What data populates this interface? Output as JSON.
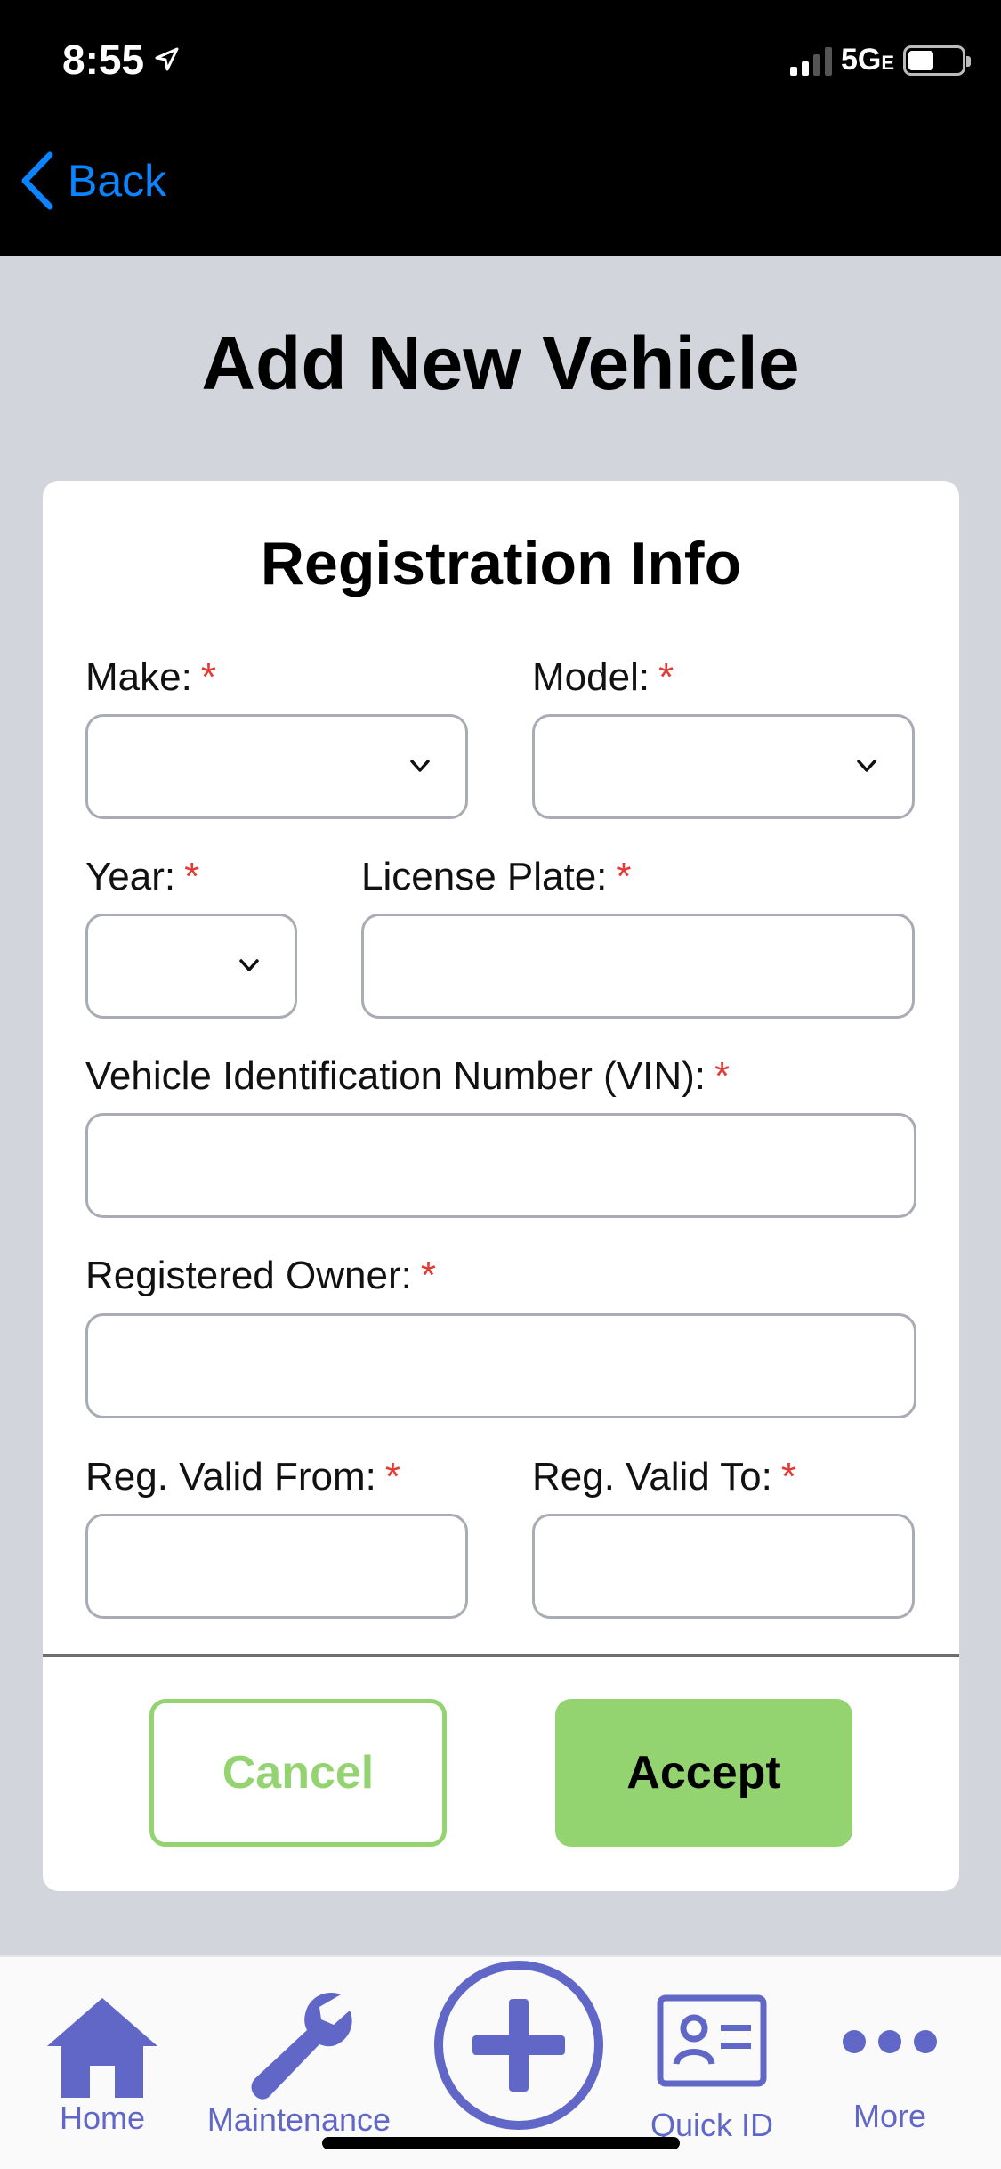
{
  "status": {
    "time": "8:55",
    "network": "5G",
    "network_sub": "E"
  },
  "nav": {
    "back_label": "Back"
  },
  "page": {
    "title": "Add New Vehicle"
  },
  "form": {
    "section_title": "Registration Info",
    "required_marker": "*",
    "make_label": "Make:",
    "model_label": "Model:",
    "year_label": "Year:",
    "plate_label": "License Plate:",
    "vin_label": "Vehicle Identification Number (VIN):",
    "owner_label": "Registered Owner:",
    "valid_from_label": "Reg. Valid From:",
    "valid_to_label": "Reg. Valid To:"
  },
  "actions": {
    "cancel_label": "Cancel",
    "accept_label": "Accept"
  },
  "tabs": [
    {
      "label": "Home",
      "icon": "home-icon"
    },
    {
      "label": "Maintenance",
      "icon": "wrench-icon"
    },
    {
      "label": "",
      "icon": "plus-circle-icon"
    },
    {
      "label": "Quick ID",
      "icon": "id-card-icon"
    },
    {
      "label": "More",
      "icon": "more-dots-icon"
    }
  ],
  "colors": {
    "accent_green": "#93d471",
    "tab_purple": "#6167c7",
    "ios_blue": "#0a84ff",
    "required_red": "#e53935"
  }
}
